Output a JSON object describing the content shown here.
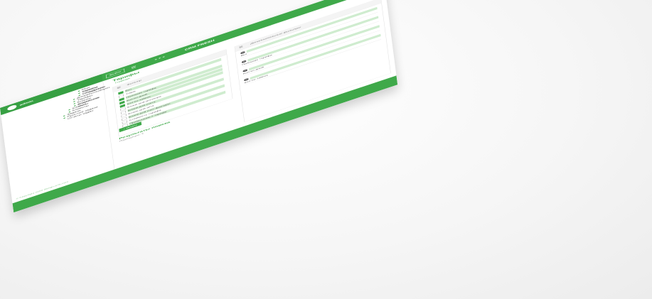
{
  "header": {
    "admin_label": "admin",
    "exit_label": "Выйти",
    "brand": "CRM FRESH",
    "crm_title": "CRM FRESH"
  },
  "sidebar": {
    "items": [
      {
        "label": "Мои клиенты"
      },
      {
        "label": "Тарифы сотрудников"
      },
      {
        "label": "Сотрудники"
      },
      {
        "label": "Документооборот"
      },
      {
        "label": "Тарифы"
      },
      {
        "label": "Бланки документов"
      },
      {
        "label": "Клиентская зона"
      },
      {
        "label": "Клиенты"
      },
      {
        "label": "Клиенты"
      },
      {
        "label": "Задачи"
      },
      {
        "label": "Простые задачи"
      },
      {
        "label": "Отчеты задач"
      }
    ],
    "copyright": "© Copyright 2020 design-b2b.com"
  },
  "page": {
    "title": "Тарифы",
    "breadcrumb": "Главная"
  },
  "filter": {
    "title": "Фильтр",
    "rows": [
      {
        "label": "Вкл",
        "checked": true
      },
      {
        "label": "ТЧБО",
        "checked": false
      },
      {
        "label": "Название тарифа",
        "checked": true
      },
      {
        "label": "Кол-во дней",
        "checked": true
      },
      {
        "label": "Кол-во заявок",
        "checked": true
      },
      {
        "label": "Бланк для договора",
        "checked": false
      },
      {
        "label": "Бланк для счета",
        "checked": false
      },
      {
        "label": "Бланк для акта",
        "checked": false
      },
      {
        "label": "Бланк для счет-фактуры",
        "checked": false
      },
      {
        "label": "Стоимость тарифа",
        "checked": false
      },
      {
        "label": "Примечание к тарифу",
        "checked": false
      }
    ],
    "search_label": "Искать"
  },
  "results": {
    "title": "Результаты поиска",
    "subtitle": "Подходящих: 3"
  },
  "additional_filter": {
    "title": "Дополнительные фильтры",
    "fields": [
      {
        "badge": "0",
        "label": "Вкл"
      },
      {
        "badge": "0",
        "label": "Название тарифа"
      },
      {
        "badge": "0",
        "label": "Кол-во дней"
      },
      {
        "badge": "0",
        "label": "Кол-во заявок"
      }
    ]
  },
  "colors": {
    "accent": "#3fa94a",
    "accent_light": "#cfeccf"
  }
}
